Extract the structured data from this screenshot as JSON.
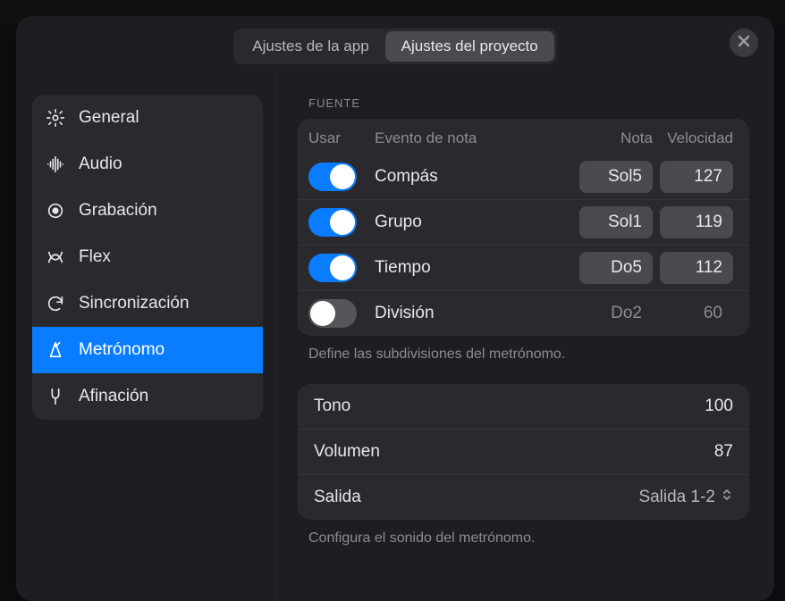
{
  "tabs": {
    "app": "Ajustes de la app",
    "project": "Ajustes del proyecto",
    "active": "project"
  },
  "sidebar": {
    "items": [
      {
        "id": "general",
        "label": "General"
      },
      {
        "id": "audio",
        "label": "Audio"
      },
      {
        "id": "recording",
        "label": "Grabación"
      },
      {
        "id": "flex",
        "label": "Flex"
      },
      {
        "id": "sync",
        "label": "Sincronización"
      },
      {
        "id": "metronome",
        "label": "Metrónomo"
      },
      {
        "id": "tuning",
        "label": "Afinación"
      }
    ],
    "active": "metronome"
  },
  "source": {
    "section_title": "FUENTE",
    "head": {
      "use": "Usar",
      "event": "Evento de nota",
      "note": "Nota",
      "velocity": "Velocidad"
    },
    "rows": [
      {
        "on": true,
        "label": "Compás",
        "note": "Sol5",
        "vel": "127"
      },
      {
        "on": true,
        "label": "Grupo",
        "note": "Sol1",
        "vel": "119"
      },
      {
        "on": true,
        "label": "Tiempo",
        "note": "Do5",
        "vel": "112"
      },
      {
        "on": false,
        "label": "División",
        "note": "Do2",
        "vel": "60"
      }
    ],
    "hint": "Define las subdivisiones del metrónomo."
  },
  "sound": {
    "rows": {
      "tone": {
        "label": "Tono",
        "value": "100"
      },
      "volume": {
        "label": "Volumen",
        "value": "87"
      },
      "output": {
        "label": "Salida",
        "value": "Salida 1-2"
      }
    },
    "hint": "Configura el sonido del metrónomo."
  }
}
